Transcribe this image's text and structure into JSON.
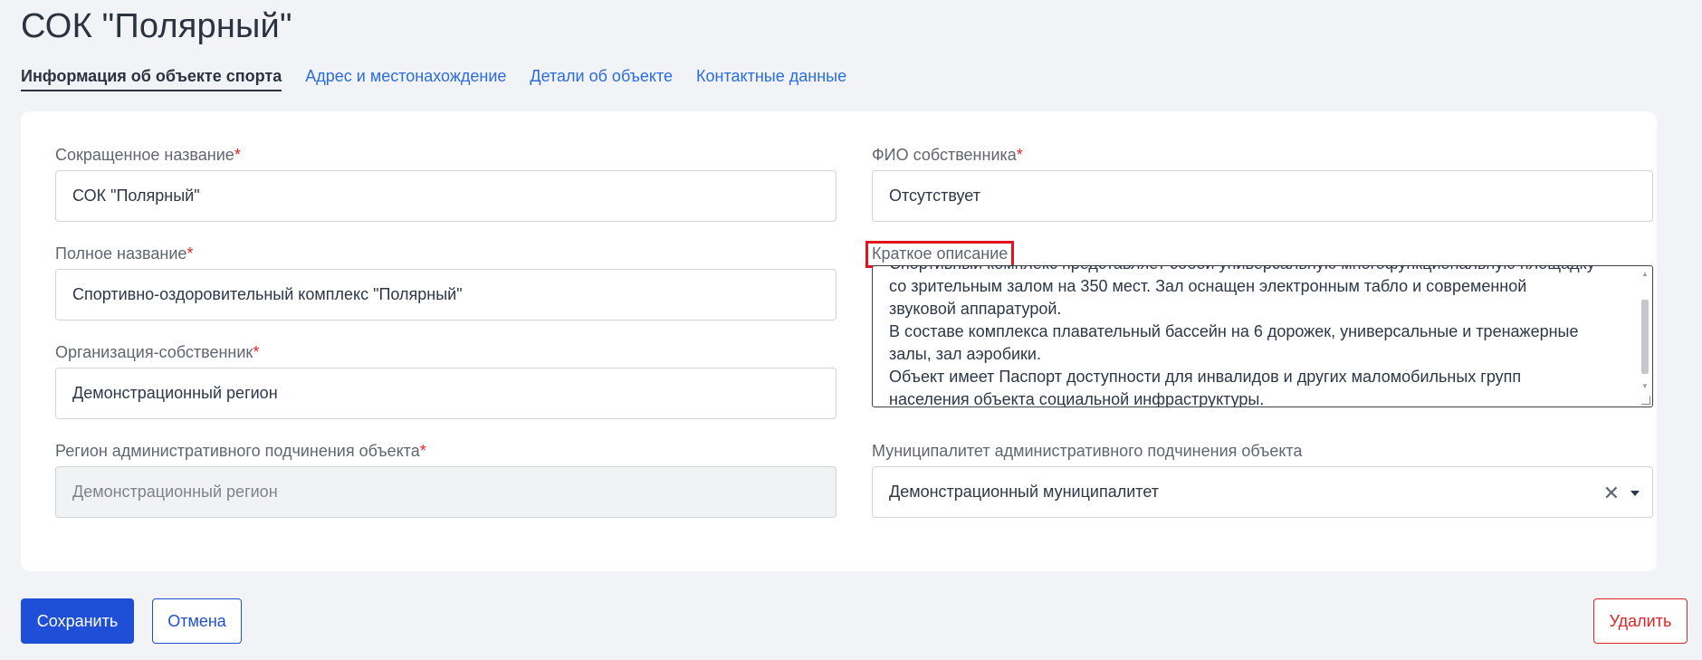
{
  "page": {
    "title": "СОК \"Полярный\""
  },
  "tabs": [
    {
      "label": "Информация об объекте спорта",
      "active": true
    },
    {
      "label": "Адрес и местонахождение",
      "active": false
    },
    {
      "label": "Детали об объекте",
      "active": false
    },
    {
      "label": "Контактные данные",
      "active": false
    }
  ],
  "form": {
    "short_name": {
      "label": "Сокращенное название",
      "required": "*",
      "value": "СОК \"Полярный\""
    },
    "full_name": {
      "label": "Полное название",
      "required": "*",
      "value": "Спортивно-оздоровительный комплекс \"Полярный\""
    },
    "org_owner": {
      "label": "Организация-собственник",
      "required": "*",
      "value": "Демонстрационный регион"
    },
    "region": {
      "label": "Регион административного подчинения объекта",
      "required": "*",
      "value": "Демонстрационный регион"
    },
    "owner_fio": {
      "label": "ФИО собственника",
      "required": "*",
      "value": "Отсутствует"
    },
    "description": {
      "label": "Краткое описание",
      "lines": [
        "Спортивный комплекс представляет собой универсальную многофункциональную площадку",
        "со зрительным залом на 350 мест. Зал оснащен электронным табло и современной",
        "звуковой аппаратурой.",
        "В составе  комплекса плавательный бассейн на 6 дорожек, универсальные и тренажерные",
        "залы, зал аэробики.",
        "Объект имеет Паспорт доступности для инвалидов и других маломобильных групп",
        "населения объекта социальной инфраструктуры."
      ]
    },
    "municipality": {
      "label": "Муниципалитет административного подчинения объекта",
      "value": "Демонстрационный муниципалитет",
      "clear_glyph": "✕"
    }
  },
  "actions": {
    "save": "Сохранить",
    "cancel": "Отмена",
    "delete": "Удалить"
  },
  "icons": {
    "clear": "close-icon",
    "dropdown": "caret-down-icon",
    "scroll_up": "chevron-up-icon",
    "scroll_down": "chevron-down-icon",
    "resize": "resize-handle-icon"
  },
  "colors": {
    "primary": "#1e4fd6",
    "link": "#2b6cdf",
    "danger": "#e02424",
    "highlight": "#e0141e"
  }
}
